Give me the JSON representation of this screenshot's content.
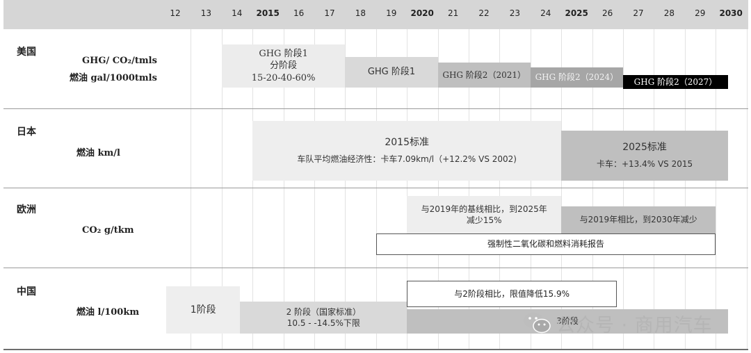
{
  "chart_data": {
    "type": "table",
    "years": [
      "12",
      "13",
      "14",
      "2015",
      "16",
      "17",
      "18",
      "19",
      "2020",
      "21",
      "22",
      "23",
      "24",
      "2025",
      "26",
      "27",
      "28",
      "29",
      "2030"
    ],
    "rows": [
      {
        "region": "美国",
        "metric": [
          "GHG/ CO₂/tmls",
          "燃油 gal/1000tmls"
        ],
        "bars": [
          {
            "lines": [
              "GHG 阶段1",
              "分阶段",
              "15-20-40-60%"
            ],
            "start": 2014,
            "end": 2018,
            "fill": "#ececec",
            "text": "#333333"
          },
          {
            "lines": [
              "GHG 阶段1"
            ],
            "start": 2018,
            "end": 2021,
            "fill": "#d9d9d9",
            "text": "#333333"
          },
          {
            "lines": [
              "GHG 阶段2（2021）"
            ],
            "start": 2021,
            "end": 2024,
            "fill": "#bfbfbf",
            "text": "#333333"
          },
          {
            "lines": [
              "GHG 阶段2（2024）"
            ],
            "start": 2024,
            "end": 2027,
            "fill": "#a6a6a6",
            "text": "#f2f2f2"
          },
          {
            "lines": [
              "GHG 阶段2（2027）"
            ],
            "start": 2027,
            "end": 2030.4,
            "fill": "#000000",
            "text": "#ffffff"
          }
        ]
      },
      {
        "region": "日本",
        "metric": [
          "燃油    km/l"
        ],
        "bars": [
          {
            "lines": [
              "2015标准",
              "车队平均燃油经济性：卡车7.09km/l（+12.2% VS 2002)"
            ],
            "start": 2015,
            "end": 2025,
            "fill": "#eeeeee",
            "text": "#333333"
          },
          {
            "lines": [
              "2025标准",
              "卡车：+13.4% VS 2015"
            ],
            "start": 2025,
            "end": 2030.4,
            "fill": "#bfbfbf",
            "text": "#333333"
          }
        ]
      },
      {
        "region": "欧洲",
        "metric": [
          "CO₂  g/tkm"
        ],
        "bars": [
          {
            "lines": [
              "与2019年的基线相比，到2025年",
              "减少15%"
            ],
            "start": 2020,
            "end": 2025,
            "fill": "#eeeeee",
            "text": "#333333"
          },
          {
            "lines": [
              "与2019年相比，到2030年减少"
            ],
            "start": 2025,
            "end": 2030,
            "fill": "#bfbfbf",
            "text": "#333333"
          },
          {
            "lines": [
              "强制性二氧化碳和燃料消耗报告"
            ],
            "start": 2019,
            "end": 2030,
            "fill": "#ffffff",
            "text": "#222222",
            "border": "#555555"
          }
        ]
      },
      {
        "region": "中国",
        "metric": [
          "燃油    l/100km"
        ],
        "bars": [
          {
            "lines": [
              "1阶段"
            ],
            "start": 2012.2,
            "end": 2014.6,
            "fill": "#eeeeee",
            "text": "#333333"
          },
          {
            "lines": [
              "2 阶段（国家标准）",
              "10.5 - -14.5%下限"
            ],
            "start": 2014.6,
            "end": 2020,
            "fill": "#d9d9d9",
            "text": "#333333"
          },
          {
            "lines": [
              "3阶段"
            ],
            "start": 2020,
            "end": 2030.4,
            "fill": "#bfbfbf",
            "text": "#333333"
          },
          {
            "lines": [
              "与2阶段相比，限值降低15.9%"
            ],
            "start": 2020,
            "end": 2026.8,
            "fill": "#ffffff",
            "text": "#222222",
            "border": "#555555"
          }
        ]
      }
    ]
  },
  "watermark": "公众号 · 商用汽车"
}
